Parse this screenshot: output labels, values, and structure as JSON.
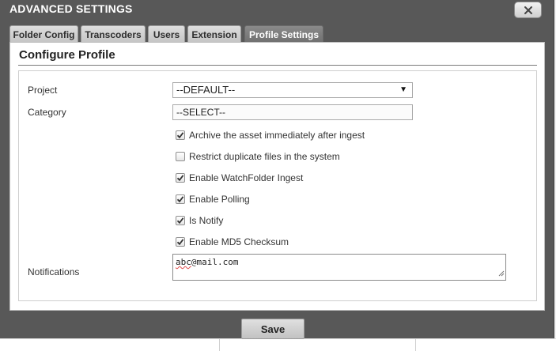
{
  "dialog": {
    "title": "ADVANCED SETTINGS",
    "close_icon": "close-icon"
  },
  "tabs": [
    {
      "label": "Folder Config",
      "active": false
    },
    {
      "label": "Transcoders",
      "active": false
    },
    {
      "label": "Users",
      "active": false
    },
    {
      "label": "Extension",
      "active": false
    },
    {
      "label": "Profile Settings",
      "active": true
    }
  ],
  "panel": {
    "title": "Configure Profile",
    "project": {
      "label": "Project",
      "selected": "--DEFAULT--"
    },
    "category": {
      "label": "Category",
      "selected": "--SELECT--"
    },
    "options": [
      {
        "label": "Archive the asset immediately after ingest",
        "checked": true
      },
      {
        "label": "Restrict duplicate files in the system",
        "checked": false
      },
      {
        "label": "Enable WatchFolder Ingest",
        "checked": true
      },
      {
        "label": "Enable Polling",
        "checked": true
      },
      {
        "label": "Is Notify",
        "checked": true
      },
      {
        "label": "Enable MD5 Checksum",
        "checked": true
      }
    ],
    "notifications": {
      "label": "Notifications",
      "value_typo": "abc",
      "value_rest": "@mail.com"
    }
  },
  "footer": {
    "save_label": "Save"
  },
  "colors": {
    "dialog_bg": "#585858",
    "active_tab": "#7c7c7c",
    "spellcheck": "#e04a4a"
  }
}
